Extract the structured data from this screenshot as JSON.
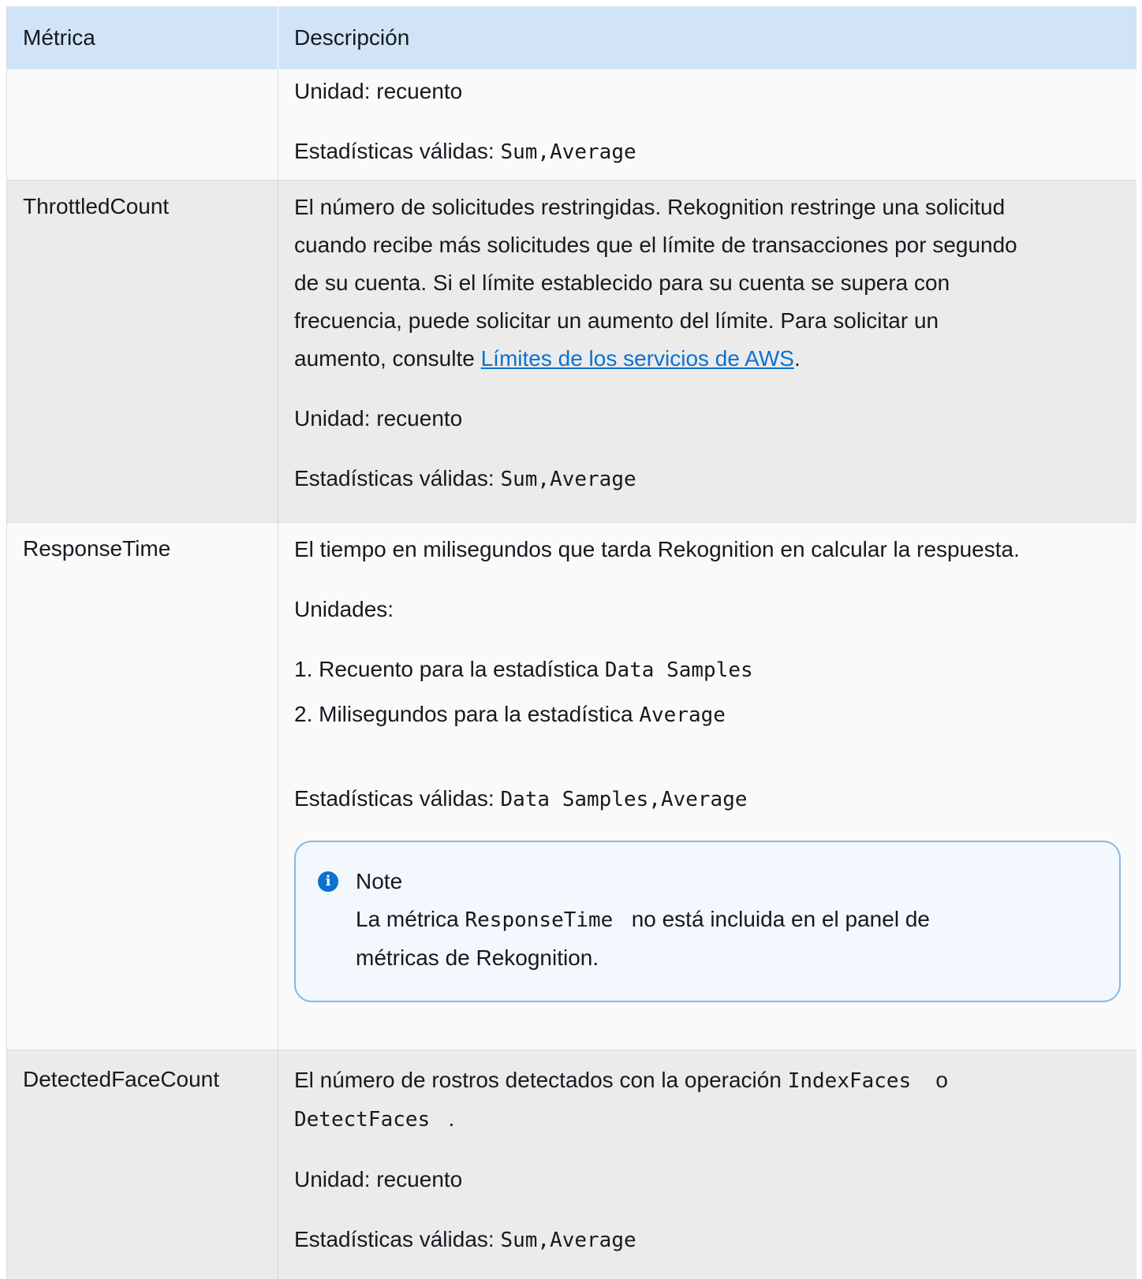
{
  "header": {
    "col_metric": "Métrica",
    "col_description": "Descripción"
  },
  "row0": {
    "unit": "Unidad: recuento",
    "stats_label": "Estadísticas válidas:",
    "stats_code": "Sum,Average"
  },
  "row1": {
    "name": "ThrottledCount",
    "desc_line1": "El número de solicitudes restringidas. Rekognition restringe una solicitud",
    "desc_line2": "cuando recibe más solicitudes que el límite de transacciones por segundo",
    "desc_line3": "de su cuenta. Si el límite establecido para su cuenta se supera con",
    "desc_line4": "frecuencia, puede solicitar un aumento del límite. Para solicitar un",
    "desc_line5_pre": "aumento, consulte ",
    "desc_link": "Límites de los servicios de AWS",
    "desc_line5_post": ".",
    "unit": "Unidad: recuento",
    "stats_label": "Estadísticas válidas:",
    "stats_code": "Sum,Average"
  },
  "row2": {
    "name": "ResponseTime",
    "desc": "El tiempo en milisegundos que tarda Rekognition en calcular la respuesta.",
    "units_label": "Unidades:",
    "list": [
      {
        "num": "1.",
        "text": "Recuento para la estadística",
        "code": "Data Samples"
      },
      {
        "num": "2.",
        "text": "Milisegundos para la estadística",
        "code": "Average"
      }
    ],
    "stats_label": "Estadísticas válidas:",
    "stats_code": "Data Samples,Average",
    "note": {
      "title": "Note",
      "icon": "info-icon",
      "body_pre": "La métrica",
      "body_code": "ResponseTime",
      "body_post": "no está incluida en el panel de",
      "body_line2": "métricas de Rekognition."
    }
  },
  "row3": {
    "name": "DetectedFaceCount",
    "desc_pre": "El número de rostros detectados con la operación",
    "code1": "IndexFaces",
    "desc_mid": "o",
    "code2": "DetectFaces",
    "desc_post": ".",
    "unit": "Unidad: recuento",
    "stats_label": "Estadísticas válidas:",
    "stats_code": "Sum,Average"
  },
  "colors": {
    "header_bg": "#d1e4f7",
    "link": "#0972d3",
    "note_border": "#88b8e0"
  }
}
